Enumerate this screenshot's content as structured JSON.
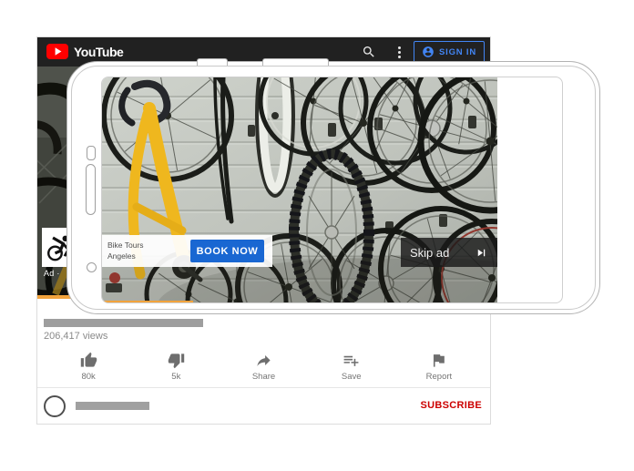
{
  "header": {
    "brand": "YouTube",
    "sign_in_label": "SIGN IN"
  },
  "page_ad": {
    "ad_label": "Ad ·"
  },
  "phone_ad": {
    "advertiser_line1": "Bike Tours",
    "advertiser_line2": "Angeles",
    "cta_label": "BOOK NOW",
    "skip_label": "Skip ad"
  },
  "video_info": {
    "views": "206,417 views"
  },
  "actions": [
    {
      "icon": "thumb-up-icon",
      "label": "80k"
    },
    {
      "icon": "thumb-down-icon",
      "label": "5k"
    },
    {
      "icon": "share-icon",
      "label": "Share"
    },
    {
      "icon": "playlist-add-icon",
      "label": "Save"
    },
    {
      "icon": "flag-icon",
      "label": "Report"
    }
  ],
  "channel": {
    "subscribe_label": "SUBSCRIBE"
  },
  "colors": {
    "brand-red": "#ff0000",
    "header-bg": "#212121",
    "signin-blue": "#4285f4",
    "cta-blue": "#1967d2",
    "subscribe-red": "#cc0000",
    "progress-yellow": "#f2a33c"
  }
}
